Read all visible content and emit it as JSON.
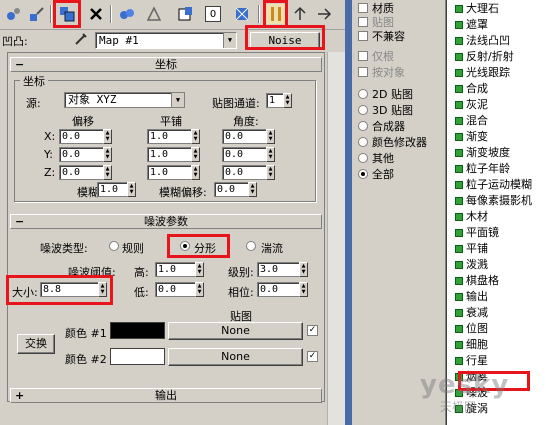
{
  "toolbar": {
    "icons": [
      "spheres-icon",
      "pick-material-icon",
      "assign-material-icon",
      "delete-icon",
      "copy-icon",
      "make-unique-icon",
      "put-library-icon",
      "material-id-icon",
      "show-map-icon",
      "show-end-result-icon",
      "go-parent-icon"
    ],
    "material_id": "0"
  },
  "name_row": {
    "label": "凹凸:",
    "map_name": "Map #1",
    "map_type": "Noise"
  },
  "coords": {
    "header": "坐标",
    "group_title": "坐标",
    "source_label": "源:",
    "source_value": "对象 XYZ",
    "map_channel_label": "贴图通道:",
    "map_channel_value": "1",
    "col_offset": "偏移",
    "col_tiling": "平铺",
    "col_angle": "角度:",
    "rows": [
      {
        "axis": "X:",
        "offset": "0.0",
        "tiling": "1.0",
        "angle": "0.0"
      },
      {
        "axis": "Y:",
        "offset": "0.0",
        "tiling": "1.0",
        "angle": "0.0"
      },
      {
        "axis": "Z:",
        "offset": "0.0",
        "tiling": "1.0",
        "angle": "0.0"
      }
    ],
    "blur_label": "模糊:",
    "blur_value": "1.0",
    "blur_offset_label": "模糊偏移:",
    "blur_offset_value": "0.0"
  },
  "noise": {
    "header": "噪波参数",
    "type_label": "噪波类型:",
    "type_regular": "规则",
    "type_fractal": "分形",
    "type_turbulence": "湍流",
    "threshold_label": "噪波阈值:",
    "high_label": "高:",
    "high_value": "1.0",
    "levels_label": "级别:",
    "levels_value": "3.0",
    "size_label": "大小:",
    "size_value": "8.8",
    "low_label": "低:",
    "low_value": "0.0",
    "phase_label": "相位:",
    "phase_value": "0.0",
    "maps_label": "贴图",
    "swap_label": "交换",
    "color1_label": "颜色 #1",
    "color2_label": "颜色 #2",
    "color1": "#000000",
    "color2": "#ffffff",
    "map1": "None",
    "map2": "None",
    "check_mark": "✓"
  },
  "output": {
    "header": "输出"
  },
  "browse_from": {
    "checks": [
      "材质",
      "贴图",
      "不兼容",
      "仅根",
      "按对象"
    ],
    "radios": [
      "2D 贴图",
      "3D 贴图",
      "合成器",
      "颜色修改器",
      "其他",
      "全部"
    ],
    "selected_radio": 5
  },
  "map_list": [
    "大理石",
    "遮罩",
    "法线凸凹",
    "反射/折射",
    "光线跟踪",
    "合成",
    "灰泥",
    "混合",
    "渐变",
    "渐变坡度",
    "粒子年龄",
    "粒子运动模糊",
    "每像素摄影机",
    "木材",
    "平面镜",
    "平铺",
    "泼溅",
    "棋盘格",
    "输出",
    "衰减",
    "位图",
    "细胞",
    "行星",
    "烟雾",
    "噪波",
    "旋涡"
  ],
  "watermark": {
    "main": "yesky",
    "sub": "天极网"
  }
}
